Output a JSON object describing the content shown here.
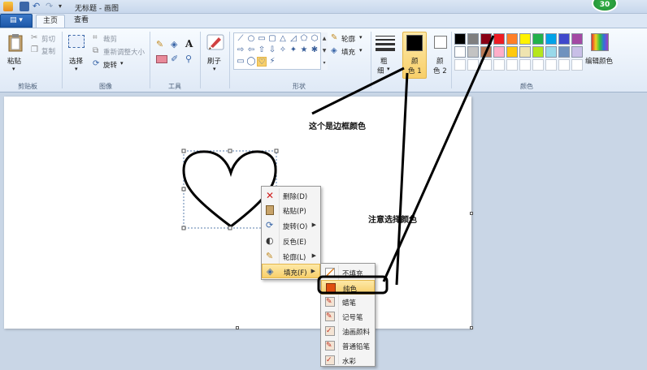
{
  "window": {
    "title": "无标题 - 画图",
    "badge": "30"
  },
  "tabs": {
    "file": "▤ ▾",
    "home": "主页",
    "view": "查看"
  },
  "ribbon": {
    "clipboard": {
      "paste": "粘贴",
      "cut": "剪切",
      "copy": "复制",
      "label": "剪贴板"
    },
    "image": {
      "select": "选择",
      "crop": "裁剪",
      "resize": "重新调整大小",
      "rotate": "旋转",
      "label": "图像"
    },
    "tools": {
      "label": "工具"
    },
    "brushes": {
      "label": "刷子"
    },
    "shapes": {
      "outline": "轮廓",
      "fill": "填充",
      "label": "形状"
    },
    "size": {
      "label1": "粗",
      "label2": "细"
    },
    "color1": {
      "label1": "颜",
      "label2": "色 1"
    },
    "color2": {
      "label1": "颜",
      "label2": "色 2"
    },
    "colors": {
      "edit": "编辑颜色",
      "label": "颜色"
    }
  },
  "palette": {
    "row1": [
      "#000000",
      "#7f7f7f",
      "#880015",
      "#ed1c24",
      "#ff7f27",
      "#fff200",
      "#22b14c",
      "#00a2e8",
      "#3f48cc",
      "#a349a4"
    ],
    "row2": [
      "#ffffff",
      "#c3c3c3",
      "#b97a57",
      "#ffaec9",
      "#ffc90e",
      "#efe4b0",
      "#b5e61d",
      "#99d9ea",
      "#7092be",
      "#c8bfe7"
    ],
    "row3": [
      "#ffffff",
      "#ffffff",
      "#ffffff",
      "#ffffff",
      "#ffffff",
      "#ffffff",
      "#ffffff",
      "#ffffff",
      "#ffffff",
      "#ffffff"
    ],
    "color1_value": "#000000",
    "color2_value": "#ffffff"
  },
  "context_menu": {
    "items": [
      {
        "label": "删除(D)",
        "icon": "delete-x-icon"
      },
      {
        "label": "粘贴(P)",
        "icon": "paste-icon"
      },
      {
        "label": "旋转(O)",
        "icon": "rotate-icon"
      },
      {
        "label": "反色(E)",
        "icon": "invert-color-icon"
      },
      {
        "label": "轮廓(L)",
        "icon": "outline-icon"
      },
      {
        "label": "填充(F)",
        "icon": "fill-icon"
      }
    ]
  },
  "fill_submenu": {
    "items": [
      {
        "label": "不填充"
      },
      {
        "label": "纯色"
      },
      {
        "label": "蜡笔"
      },
      {
        "label": "记号笔"
      },
      {
        "label": "油画颜料"
      },
      {
        "label": "普通铅笔"
      },
      {
        "label": "水彩"
      }
    ]
  },
  "annotations": {
    "border_color": "这个是边框颜色",
    "choose_color": "注意选择颜色"
  },
  "accent": {
    "highlight": "#f8cf6a",
    "ribbon": "#dfe9f6"
  }
}
